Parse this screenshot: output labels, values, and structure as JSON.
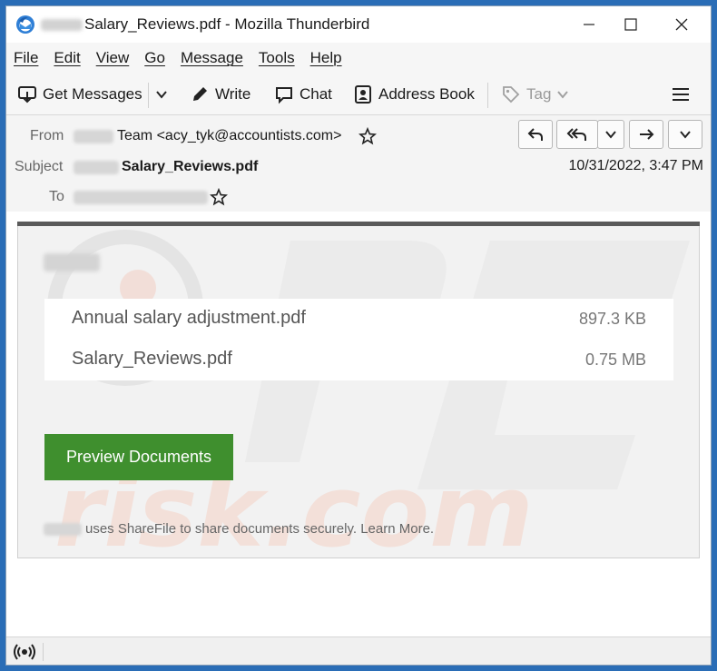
{
  "window": {
    "title": "Salary_Reviews.pdf - Mozilla Thunderbird",
    "controls": [
      "minimize-icon",
      "maximize-icon",
      "close-icon"
    ]
  },
  "menu": [
    "File",
    "Edit",
    "View",
    "Go",
    "Message",
    "Tools",
    "Help"
  ],
  "toolbar": {
    "get_messages": "Get Messages",
    "write": "Write",
    "chat": "Chat",
    "address_book": "Address Book",
    "tag": "Tag",
    "icons": [
      "download-icon",
      "pencil-icon",
      "chat-bubble-icon",
      "address-book-icon",
      "tag-icon",
      "hamburger-menu-icon"
    ]
  },
  "header": {
    "from_label": "From",
    "from_value": "Team <acy_tyk@accountists.com>",
    "subject_label": "Subject",
    "subject_value": "Salary_Reviews.pdf",
    "to_label": "To",
    "date": "10/31/2022, 3:47 PM",
    "action_icons": [
      "reply-icon",
      "reply-all-icon",
      "chevron-down-icon",
      "forward-icon",
      "more-chevron-icon"
    ]
  },
  "message": {
    "files": [
      {
        "name": "Annual salary adjustment.pdf",
        "size": "897.3 KB"
      },
      {
        "name": "Salary_Reviews.pdf",
        "size": "0.75 MB"
      }
    ],
    "button": "Preview Documents",
    "footer": "uses ShareFile to share documents securely. Learn More."
  },
  "colors": {
    "accent_green": "#3f8f2e",
    "title_bar_frame": "#2a6db6",
    "watermark_red": "#e25a3c"
  }
}
